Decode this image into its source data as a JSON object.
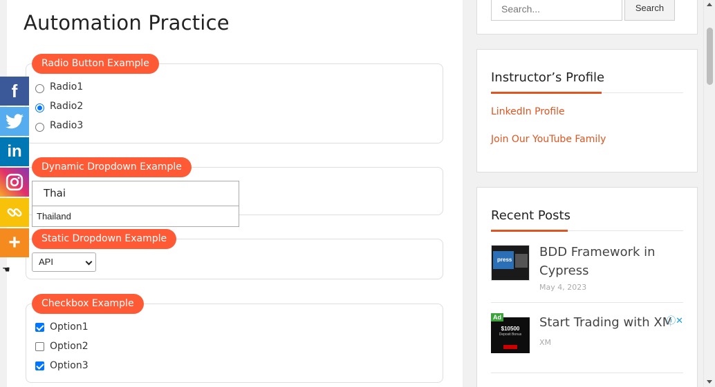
{
  "page": {
    "title": "Automation Practice"
  },
  "radio_section": {
    "legend": "Radio Button Example",
    "options": [
      {
        "label": "Radio1",
        "checked": false
      },
      {
        "label": "Radio2",
        "checked": true
      },
      {
        "label": "Radio3",
        "checked": false
      }
    ]
  },
  "dynamic_dropdown": {
    "legend": "Dynamic Dropdown Example",
    "input_value": "Thai",
    "suggestion": "Thailand"
  },
  "static_dropdown": {
    "legend": "Static Dropdown Example",
    "selected": "API"
  },
  "checkbox_section": {
    "legend": "Checkbox Example",
    "options": [
      {
        "label": "Option1",
        "checked": true
      },
      {
        "label": "Option2",
        "checked": false
      },
      {
        "label": "Option3",
        "checked": true
      }
    ]
  },
  "sidebar": {
    "search": {
      "placeholder": "Search...",
      "button": "Search"
    },
    "instructor": {
      "title": "Instructor’s Profile",
      "links": [
        "LinkedIn Profile",
        "Join Our YouTube Family"
      ]
    },
    "recent_posts": {
      "title": "Recent Posts",
      "posts": [
        {
          "title_line1": "BDD Framework in",
          "title_line2": "Cypress",
          "date": "May 4, 2023"
        },
        {
          "title": "Start Trading with XM",
          "source": "XM",
          "badge": "Ad",
          "ad_headline": "$10500",
          "ad_sub": "Deposit Bonus"
        }
      ]
    }
  },
  "share_bar": {
    "buttons": [
      {
        "name": "facebook",
        "glyph": "f",
        "color": "#3b5998"
      },
      {
        "name": "twitter",
        "glyph": "t",
        "color": "#55acee"
      },
      {
        "name": "linkedin",
        "glyph": "in",
        "color": "#0077b5"
      },
      {
        "name": "instagram",
        "glyph": "◎",
        "color": "#c13584"
      },
      {
        "name": "copy-link",
        "glyph": "⛓",
        "color": "#f9c20a"
      },
      {
        "name": "more",
        "glyph": "+",
        "color": "#f58b1f"
      }
    ]
  },
  "colors": {
    "accent": "#ff5a36",
    "link": "#e2541f",
    "checkbox": "#0075ff"
  }
}
